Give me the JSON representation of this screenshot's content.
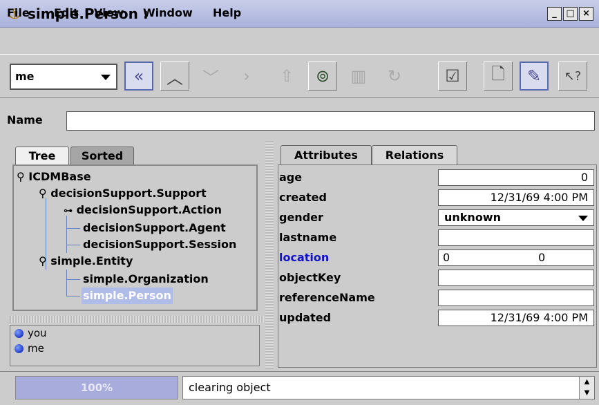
{
  "window": {
    "title": "simple.Person :",
    "min": "_",
    "max": "□",
    "close": "×"
  },
  "menu": [
    {
      "label": "File"
    },
    {
      "label": "Edit"
    },
    {
      "label": "View"
    },
    {
      "label": "Window"
    },
    {
      "label": "Help"
    }
  ],
  "toolbar": {
    "combo_value": "me"
  },
  "name_row": {
    "label": "Name",
    "value": ""
  },
  "tree_tabs": [
    {
      "label": "Tree"
    },
    {
      "label": "Sorted"
    }
  ],
  "tree": [
    {
      "label": "ICDMBase"
    },
    {
      "label": "decisionSupport.Support"
    },
    {
      "label": "decisionSupport.Action"
    },
    {
      "label": "decisionSupport.Agent"
    },
    {
      "label": "decisionSupport.Session"
    },
    {
      "label": "simple.Entity"
    },
    {
      "label": "simple.Organization"
    },
    {
      "label": "simple.Person"
    }
  ],
  "users": [
    {
      "label": "you"
    },
    {
      "label": "me"
    }
  ],
  "detail_tabs": [
    {
      "label": "Attributes"
    },
    {
      "label": "Relations"
    }
  ],
  "attributes": [
    {
      "label": "age",
      "value": "0"
    },
    {
      "label": "created",
      "value": "12/31/69 4:00 PM"
    },
    {
      "label": "gender",
      "value": "unknown"
    },
    {
      "label": "lastname",
      "value": ""
    },
    {
      "label": "location",
      "value_x": "0",
      "value_y": "0"
    },
    {
      "label": "objectKey",
      "value": ""
    },
    {
      "label": "referenceName",
      "value": ""
    },
    {
      "label": "updated",
      "value": "12/31/69 4:00 PM"
    }
  ],
  "status": {
    "progress_text": "100%",
    "progress_fraction": 1.0,
    "message": "clearing object"
  },
  "colors": {
    "link": "#1010d0",
    "selection": "#b0bce8",
    "titlebar": "#b8bfe3"
  }
}
